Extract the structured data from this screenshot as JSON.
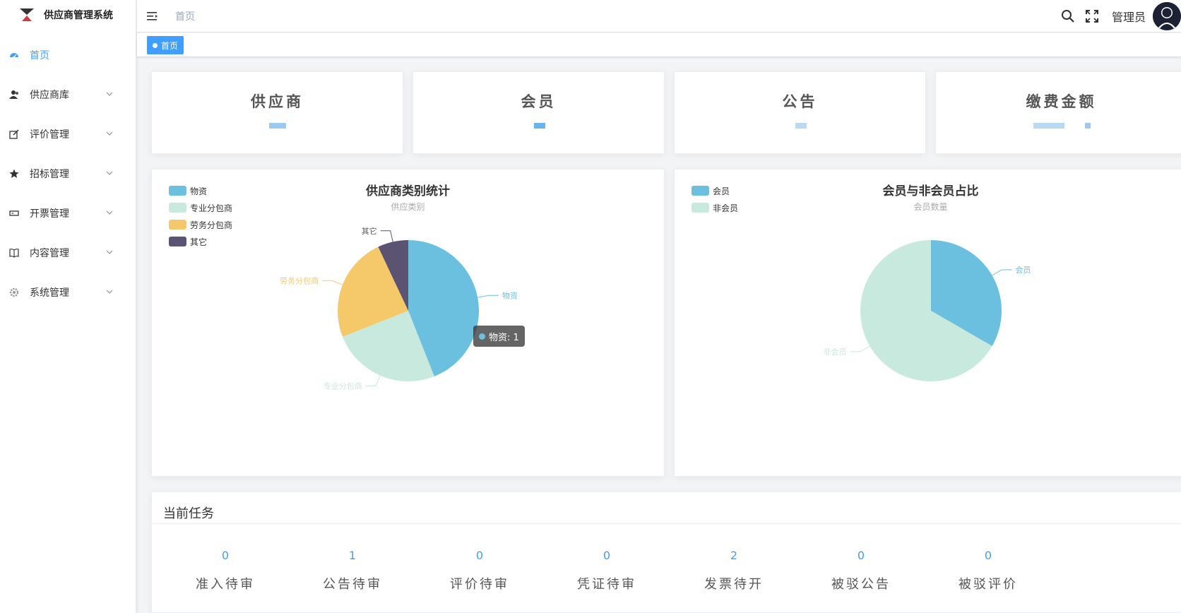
{
  "app": {
    "title": "供应商管理系统"
  },
  "sidebar": {
    "items": [
      {
        "label": "首页",
        "icon": "dashboard-icon",
        "active": true
      },
      {
        "label": "供应商库",
        "icon": "users-icon"
      },
      {
        "label": "评价管理",
        "icon": "edit-icon"
      },
      {
        "label": "招标管理",
        "icon": "star-icon"
      },
      {
        "label": "开票管理",
        "icon": "ticket-icon"
      },
      {
        "label": "内容管理",
        "icon": "book-icon"
      },
      {
        "label": "系统管理",
        "icon": "gear-icon"
      }
    ]
  },
  "header": {
    "breadcrumb": "首页",
    "username": "管理员"
  },
  "tags": {
    "active": "首页"
  },
  "stats": [
    {
      "title": "供应商"
    },
    {
      "title": "会员"
    },
    {
      "title": "公告"
    },
    {
      "title": "缴费金额"
    }
  ],
  "charts": {
    "supplier": {
      "title": "供应商类别统计",
      "subtitle": "供应类别",
      "tooltip": "物资: 1"
    },
    "member": {
      "title": "会员与非会员占比",
      "subtitle": "会员数量"
    }
  },
  "chart_data": [
    {
      "type": "pie",
      "title": "供应商类别统计",
      "subtitle": "供应类别",
      "legend_position": "top-left",
      "slices": [
        {
          "name": "物资",
          "value": 44,
          "color": "#6bbfdf"
        },
        {
          "name": "专业分包商",
          "value": 25,
          "color": "#c7e9de"
        },
        {
          "name": "劳务分包商",
          "value": 24,
          "color": "#f5c96a"
        },
        {
          "name": "其它",
          "value": 7,
          "color": "#5a5472"
        }
      ]
    },
    {
      "type": "pie",
      "title": "会员与非会员占比",
      "subtitle": "会员数量",
      "legend_position": "top-left",
      "slices": [
        {
          "name": "会员",
          "value": 1,
          "color": "#6bbfdf"
        },
        {
          "name": "非会员",
          "value": 2,
          "color": "#c7e9de"
        }
      ]
    }
  ],
  "tasks": {
    "title": "当前任务",
    "items": [
      {
        "count": "0",
        "label": "准入待审"
      },
      {
        "count": "1",
        "label": "公告待审"
      },
      {
        "count": "0",
        "label": "评价待审"
      },
      {
        "count": "0",
        "label": "凭证待审"
      },
      {
        "count": "2",
        "label": "发票待开"
      },
      {
        "count": "0",
        "label": "被驳公告"
      },
      {
        "count": "0",
        "label": "被驳评价"
      }
    ]
  },
  "colors": {
    "accent": "#409eff",
    "tag_bg": "#409eff"
  }
}
